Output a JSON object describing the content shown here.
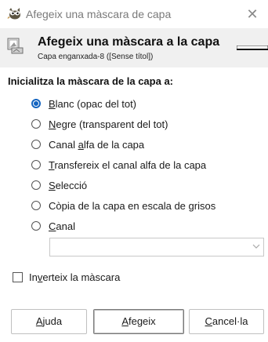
{
  "window": {
    "title": "Afegeix una màscara de capa",
    "close_glyph": "✕",
    "icon": "gimp-wilber-icon"
  },
  "header": {
    "title": "Afegeix una màscara a la capa",
    "subtitle": "Capa enganxada-8 ([Sense títol])",
    "icon": "layer-mask-icon"
  },
  "section": {
    "label": "Inicialitza la màscara de la capa a:"
  },
  "options": [
    {
      "mnemonic": "B",
      "rest": "lanc (opac del tot)",
      "checked": true
    },
    {
      "mnemonic": "N",
      "rest": "egre (transparent del tot)",
      "checked": false
    },
    {
      "before": "Canal ",
      "mnemonic": "a",
      "rest": "lfa de la capa",
      "checked": false
    },
    {
      "mnemonic": "T",
      "rest": "ransfereix el canal alfa de la capa",
      "checked": false
    },
    {
      "mnemonic": "S",
      "rest": "elecció",
      "checked": false
    },
    {
      "before": "Còpia de la capa en escala de grisos",
      "checked": false
    },
    {
      "mnemonic": "C",
      "rest": "anal",
      "checked": false
    }
  ],
  "channel_combo": {
    "value": "",
    "arrow_icon": "chevron-down-icon"
  },
  "invert": {
    "before": "In",
    "mnemonic": "v",
    "rest": "erteix la màscara",
    "checked": false
  },
  "buttons": {
    "help": {
      "mnemonic": "A",
      "rest": "juda"
    },
    "add": {
      "mnemonic": "A",
      "rest": "fegeix"
    },
    "cancel": {
      "mnemonic": "C",
      "rest": "ancel·la"
    }
  },
  "colors": {
    "accent": "#1565c0",
    "header_band": "#f0f0f0"
  }
}
